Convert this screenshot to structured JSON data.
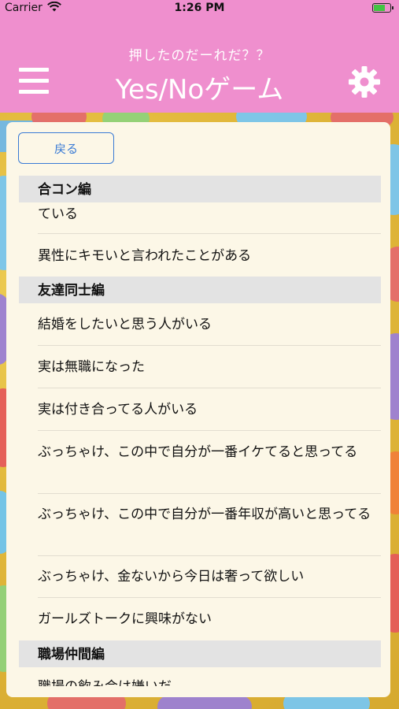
{
  "status_bar": {
    "carrier": "Carrier",
    "time": "1:26 PM"
  },
  "nav": {
    "subtitle": "押したのだーれだ？？",
    "title": "Yes/Noゲーム",
    "menu_icon": "hamburger-menu-icon",
    "settings_icon": "gear-icon"
  },
  "panel": {
    "back_label": "戻る",
    "sections": [
      {
        "header": "合コン編",
        "items": [
          "ている",
          "異性にキモいと言われたことがある"
        ]
      },
      {
        "header": "友達同士編",
        "items": [
          "結婚をしたいと思う人がいる",
          "実は無職になった",
          "実は付き合ってる人がいる",
          "ぶっちゃけ、この中で自分が一番イケてると思ってる",
          "ぶっちゃけ、この中で自分が一番年収が高いと思ってる",
          "ぶっちゃけ、金ないから今日は奢って欲しい",
          "ガールズトークに興味がない"
        ]
      },
      {
        "header": "職場仲間編",
        "items": [
          "職場の飲み会は嫌いだ"
        ]
      }
    ]
  },
  "colors": {
    "nav_background": "#ef8fce",
    "panel_background": "#fcf7e7",
    "accent": "#3a7bd5",
    "section_header": "#e3e3e3"
  }
}
